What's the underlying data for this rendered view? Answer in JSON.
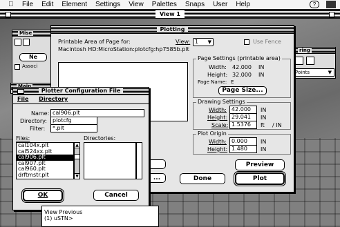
{
  "menubar": {
    "items": [
      "File",
      "Edit",
      "Element",
      "Settings",
      "View",
      "Palettes",
      "Snaps",
      "User",
      "Help"
    ]
  },
  "view_window": {
    "title": "View 1"
  },
  "palettes": {
    "misc_title": "Mise",
    "main_title": "Main",
    "misc_button": "Ne",
    "misc_check": "Associ",
    "right_title": "ring",
    "right_select": "Points"
  },
  "plotting": {
    "title": "Plotting",
    "printable_label": "Printable Area of Page for:",
    "printable_path": "Macintosh HD:MicroStation:plotcfg:hp7585b.plt",
    "view_label": "View:",
    "view_value": "1",
    "use_fence": "Use Fence",
    "page_settings": {
      "title": "Page Settings (printable area)",
      "width_label": "Width:",
      "width_value": "42.000",
      "width_unit": "IN",
      "height_label": "Height:",
      "height_value": "32.000",
      "height_unit": "IN",
      "page_name_label": "Page Name:",
      "page_name_value": "E",
      "page_size_button": "Page Size..."
    },
    "drawing_settings": {
      "title": "Drawing Settings",
      "width_label": "Width:",
      "width_value": "42.000",
      "width_unit": "IN",
      "height_label": "Height:",
      "height_value": "29.041",
      "height_unit": "IN",
      "scale_label": "Scale:",
      "scale_value": "1.5376",
      "scale_unit": "ft",
      "scale_per": "/ IN"
    },
    "plot_origin": {
      "title": "Plot Origin",
      "width_label": "Width:",
      "width_value": "0.000",
      "width_unit": "IN",
      "height_label": "Height:",
      "height_value": "1.480",
      "height_unit": "IN"
    },
    "preview_button": "Preview",
    "done_button": "Done",
    "plot_button": "Plot",
    "partial_button": "..."
  },
  "plotter_config": {
    "title": "Plotter Configuration File",
    "menu": [
      "File",
      "Directory"
    ],
    "name_label": "Name:",
    "name_value": "cal906.plt",
    "directory_label": "Directory:",
    "directory_value": "plotcfg",
    "filter_label": "Filter:",
    "filter_value": "*.plt",
    "files_label": "Files:",
    "files": [
      "cal104x.plt",
      "cal524xx.plt",
      "cal906.plt",
      "cal907.plt",
      "cal960.plt",
      "drftmstr.plt"
    ],
    "selected_file": "cal906.plt",
    "directories_label": "Directories:",
    "ok_button": "OK",
    "cancel_button": "Cancel"
  },
  "command": {
    "line1": "View Previous",
    "line2": "(1) uSTN>"
  }
}
